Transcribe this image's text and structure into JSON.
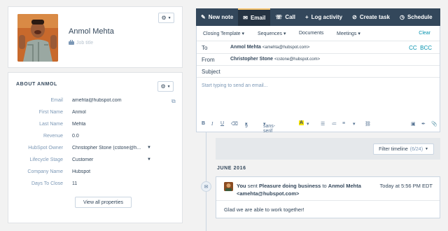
{
  "contact": {
    "name": "Anmol Mehta",
    "job_title_placeholder": "Job title"
  },
  "about": {
    "title": "ABOUT ANMOL",
    "properties": [
      {
        "label": "Email",
        "value": "amehta@hubspot.com"
      },
      {
        "label": "First Name",
        "value": "Anmol"
      },
      {
        "label": "Last Name",
        "value": "Mehta"
      },
      {
        "label": "Revenue",
        "value": "0.0"
      },
      {
        "label": "HubSpot Owner",
        "value": "Christopher Stone (cstone@h..."
      },
      {
        "label": "Lifecycle Stage",
        "value": "Customer"
      },
      {
        "label": "Company Name",
        "value": "Hubspot"
      },
      {
        "label": "Days To Close",
        "value": "11"
      }
    ],
    "view_all_label": "View all properties"
  },
  "tabs": [
    {
      "label": "New note",
      "icon": "pencil-icon"
    },
    {
      "label": "Email",
      "icon": "envelope-icon"
    },
    {
      "label": "Call",
      "icon": "phone-icon"
    },
    {
      "label": "Log activity",
      "icon": "plus-icon"
    },
    {
      "label": "Create task",
      "icon": "check-circle-icon"
    },
    {
      "label": "Schedule",
      "icon": "clock-icon"
    }
  ],
  "composer": {
    "toolbar": {
      "closing_template": "Closing Template",
      "sequences": "Sequences",
      "documents": "Documents",
      "meetings": "Meetings",
      "clear": "Clear"
    },
    "to_label": "To",
    "to_name": "Anmol Mehta",
    "to_email": "<amehta@hubspot.com>",
    "cc": "CC",
    "bcc": "BCC",
    "from_label": "From",
    "from_name": "Christopher Stone",
    "from_email": "<cstone@hubspot.com>",
    "subject_label": "Subject",
    "body_placeholder": "Start typing to send an email...",
    "font_size": "9",
    "font_family": "sans-serif"
  },
  "timeline": {
    "filter_label": "Filter timeline",
    "filter_count": "(6/24)",
    "month": "JUNE 2016",
    "email": {
      "you": "You",
      "sent": "sent",
      "subject": "Pleasure doing business",
      "to": "to",
      "recipient": "Anmol Mehta",
      "recipient_email": "<amehta@hubspot.com>",
      "time": "Today at 5:56 PM EDT",
      "body": "Glad we are able to work together!"
    }
  },
  "colors": {
    "tab_bar": "#33475b",
    "tab_active": "#253342",
    "link": "#0091ae",
    "highlight_yellow": "#f5e30a"
  }
}
